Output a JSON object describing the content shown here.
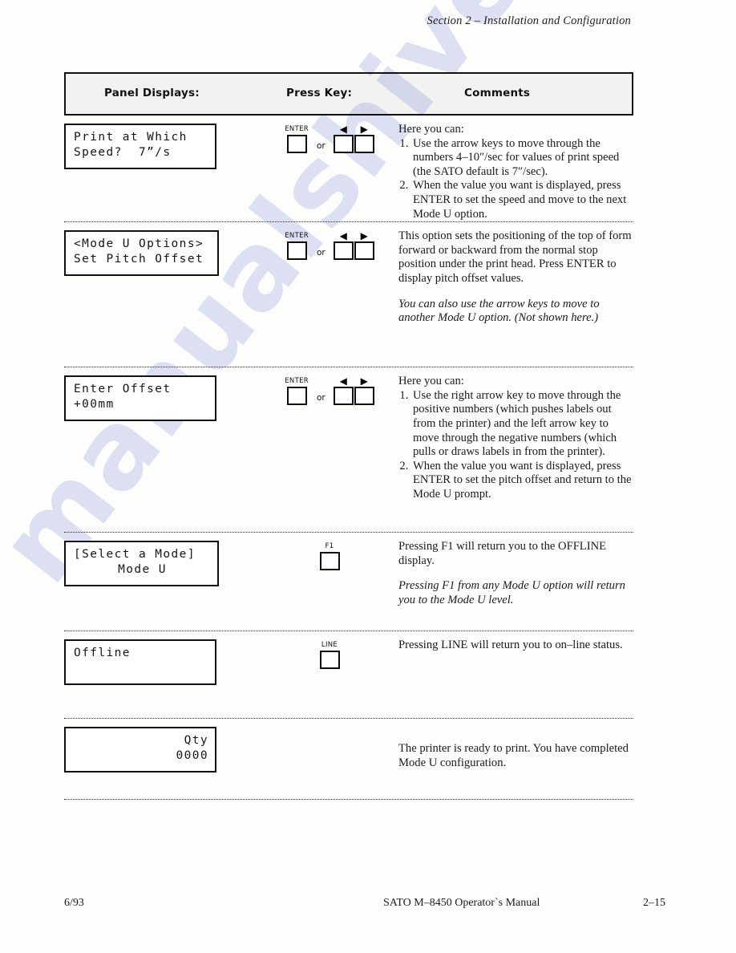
{
  "running_head": "Section 2 – Installation and Configuration",
  "table": {
    "headers": {
      "panel": "Panel Displays:",
      "key": "Press Key:",
      "comments": "Comments"
    },
    "rows": [
      {
        "display_lines": [
          "Print at Which",
          "Speed?  7”/s"
        ],
        "keys": {
          "enter_label": "ENTER",
          "or_label": "or",
          "left_arrow": "◀",
          "right_arrow": "▶"
        },
        "comment_intro": "Here you can:",
        "comment_list": [
          "Use the arrow keys to move through the numbers 4–10″/sec for values of print speed (the SATO default is 7″/sec).",
          "When the value you want is displayed, press ENTER to set the speed and move to the next Mode U option."
        ],
        "comment_italic": ""
      },
      {
        "display_lines": [
          "<Mode U Options>",
          "Set Pitch Offset"
        ],
        "keys": {
          "enter_label": "ENTER",
          "or_label": "or",
          "left_arrow": "◀",
          "right_arrow": "▶"
        },
        "comment_intro": "This option sets the positioning of the top of form forward or backward from the normal stop position under the print head.  Press ENTER to display pitch offset values.",
        "comment_list": [],
        "comment_italic": "You can also use the arrow keys to move to another Mode U option.  (Not shown here.)"
      },
      {
        "display_lines": [
          "Enter Offset",
          "+00mm"
        ],
        "keys": {
          "enter_label": "ENTER",
          "or_label": "or",
          "left_arrow": "◀",
          "right_arrow": "▶"
        },
        "comment_intro": "Here you can:",
        "comment_list": [
          "Use the right arrow key to move through the positive numbers (which pushes labels out from the printer) and the left arrow key to move through the negative numbers (which pulls or draws labels in from the printer).",
          "When the value you want is displayed, press ENTER to set the pitch offset and return to the Mode U prompt."
        ],
        "comment_italic": ""
      },
      {
        "display_lines": [
          "[Select a Mode]",
          "Mode U"
        ],
        "keys": {
          "single_label": "F1"
        },
        "comment_intro": "Pressing F1 will return you to the OFFLINE display.",
        "comment_list": [],
        "comment_italic": "Pressing F1 from any Mode U option will return you to the Mode U level."
      },
      {
        "display_lines": [
          "Offline",
          ""
        ],
        "keys": {
          "single_label": "LINE"
        },
        "comment_intro": "Pressing LINE will return you to on–line status.",
        "comment_list": [],
        "comment_italic": ""
      },
      {
        "display_lines": [
          "Qty",
          "0000"
        ],
        "keys": {},
        "comment_intro": "The printer is ready to print.  You have completed Mode U configuration.",
        "comment_list": [],
        "comment_italic": ""
      }
    ]
  },
  "footer": {
    "date": "6/93",
    "manual": "SATO M–8450 Operator`s Manual",
    "page": "2–15"
  },
  "watermark": {
    "text": "manualshive.com"
  }
}
